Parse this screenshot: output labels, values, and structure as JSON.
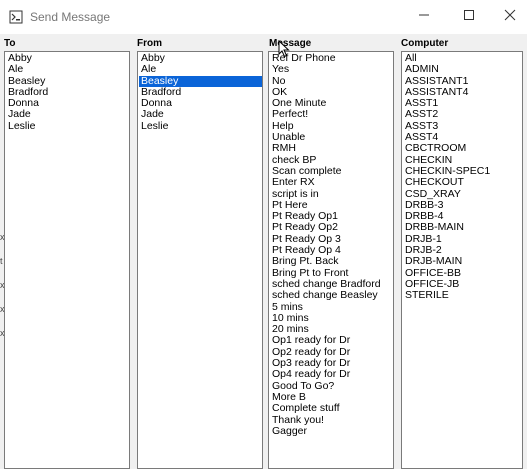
{
  "window": {
    "title": "Send Message"
  },
  "columns": {
    "to": {
      "header": "To",
      "items": [
        "Abby",
        "Ale",
        "Beasley",
        "Bradford",
        "Donna",
        "Jade",
        "Leslie"
      ]
    },
    "from": {
      "header": "From",
      "items": [
        "Abby",
        "Ale",
        "Beasley",
        "Bradford",
        "Donna",
        "Jade",
        "Leslie"
      ],
      "selected": "Beasley"
    },
    "message": {
      "header": "Message",
      "items": [
        "Ref Dr Phone",
        "Yes",
        "No",
        "OK",
        "One Minute",
        "Perfect!",
        "Help",
        "Unable",
        "RMH",
        "check BP",
        "Scan complete",
        "Enter RX",
        "script is in",
        "Pt Here",
        "Pt Ready Op1",
        "Pt Ready Op2",
        "Pt Ready Op 3",
        "Pt Ready Op 4",
        "Bring Pt. Back",
        "Bring Pt to Front",
        "sched change Bradford",
        "sched change Beasley",
        "5 mins",
        "10 mins",
        "20 mins",
        "Op1 ready for Dr",
        "Op2 ready for Dr",
        "Op3 ready for Dr",
        "Op4 ready for Dr",
        "Good To Go?",
        "More B",
        "Complete stuff",
        "Thank you!",
        "Gagger"
      ]
    },
    "computer": {
      "header": "Computer",
      "items": [
        "All",
        "ADMIN",
        "ASSISTANT1",
        "ASSISTANT4",
        "ASST1",
        "ASST2",
        "ASST3",
        "ASST4",
        "CBCTROOM",
        "CHECKIN",
        "CHECKIN-SPEC1",
        "CHECKOUT",
        "CSD_XRAY",
        "DRBB-3",
        "DRBB-4",
        "DRBB-MAIN",
        "DRJB-1",
        "DRJB-2",
        "DRJB-MAIN",
        "OFFICE-BB",
        "OFFICE-JB",
        "STERILE"
      ]
    }
  },
  "left_edge_marks": [
    "x",
    "t",
    "x",
    "x",
    "x"
  ],
  "icons": {
    "app": "app-window-icon",
    "minimize": "minimize-icon",
    "maximize": "maximize-icon",
    "close": "close-icon",
    "cursor": "mouse-pointer-icon"
  },
  "colors": {
    "selection": "#0a64d8",
    "window_bg": "#f0f0f0",
    "list_bg": "#ffffff"
  }
}
